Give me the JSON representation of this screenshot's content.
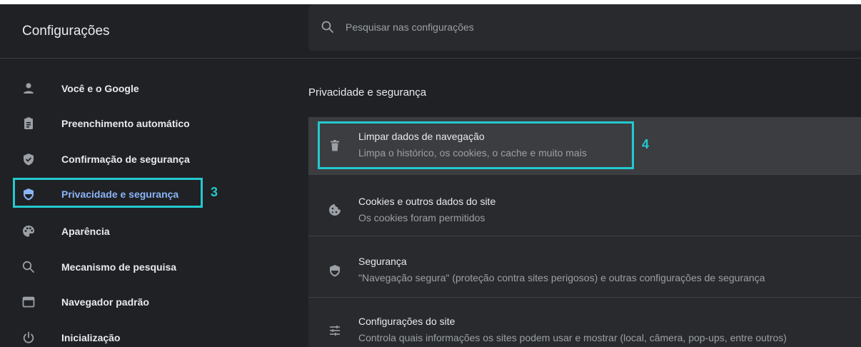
{
  "header": {
    "title": "Configurações",
    "search_placeholder": "Pesquisar nas configurações"
  },
  "sidebar": {
    "items": [
      {
        "label": "Você e o Google",
        "icon": "person-icon"
      },
      {
        "label": "Preenchimento automático",
        "icon": "clipboard-icon"
      },
      {
        "label": "Confirmação de segurança",
        "icon": "shield-check-icon"
      },
      {
        "label": "Privacidade e segurança",
        "icon": "shield-icon",
        "active": true
      },
      {
        "label": "Aparência",
        "icon": "palette-icon"
      },
      {
        "label": "Mecanismo de pesquisa",
        "icon": "search-icon"
      },
      {
        "label": "Navegador padrão",
        "icon": "browser-window-icon"
      },
      {
        "label": "Inicialização",
        "icon": "power-icon"
      }
    ]
  },
  "main": {
    "section_title": "Privacidade e segurança",
    "rows": [
      {
        "title": "Limpar dados de navegação",
        "subtitle": "Limpa o histórico, os cookies, o cache e muito mais",
        "icon": "trash-icon"
      },
      {
        "title": "Cookies e outros dados do site",
        "subtitle": "Os cookies foram permitidos",
        "icon": "cookie-icon"
      },
      {
        "title": "Segurança",
        "subtitle": "\"Navegação segura\" (proteção contra sites perigosos) e outras configurações de segurança",
        "icon": "shield-icon"
      },
      {
        "title": "Configurações do site",
        "subtitle": "Controla quais informações os sites podem usar e mostrar (local, câmera, pop-ups, entre outros)",
        "icon": "tune-icon"
      }
    ]
  },
  "annotations": {
    "step_sidebar": "3",
    "step_row": "4",
    "color": "#23c9cf"
  },
  "colors": {
    "background": "#202124",
    "card": "#292a2d",
    "text": "#e8eaed",
    "secondary_text": "#9aa0a6",
    "active": "#8ab4f8"
  }
}
